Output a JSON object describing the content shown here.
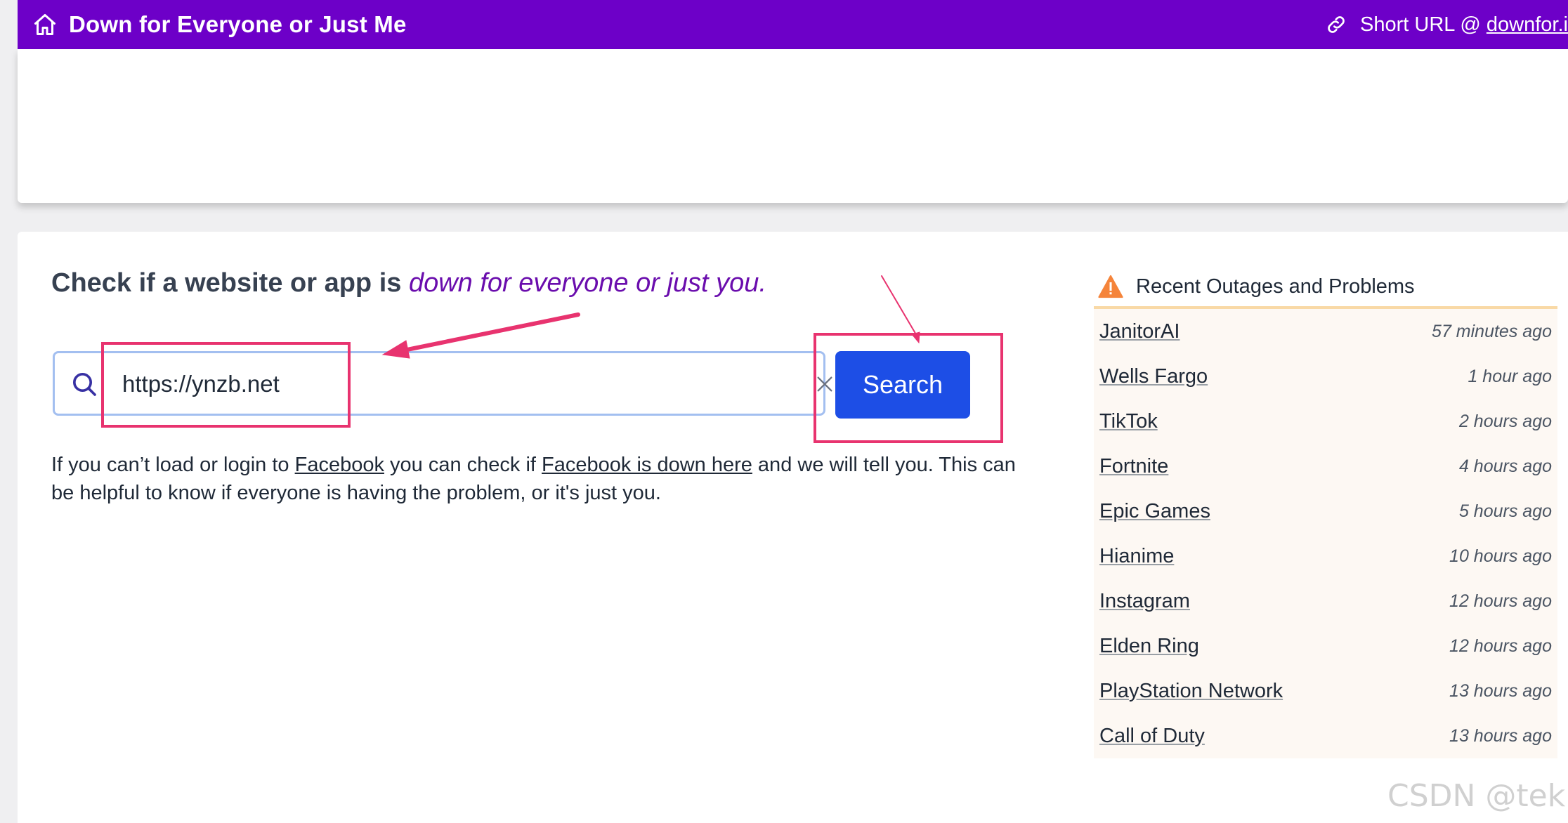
{
  "header": {
    "title": "Down for Everyone or Just Me",
    "short_url_prefix": "Short URL @ ",
    "short_url_link": "downfor.io"
  },
  "main": {
    "headline_prefix": "Check if a website or app is ",
    "headline_accent": "down for everyone or just you",
    "headline_suffix": ".",
    "search": {
      "value": "https://ynzb.net",
      "button_label": "Search"
    },
    "help": {
      "part1": "If you can’t load or login to ",
      "link1": "Facebook",
      "part2": " you can check if ",
      "link2": "Facebook is down here",
      "part3": " and we will tell you. This can be helpful to know if everyone is having the problem, or it's just you."
    }
  },
  "outages": {
    "title": "Recent Outages and Problems",
    "items": [
      {
        "name": "JanitorAI",
        "time": "57 minutes ago"
      },
      {
        "name": "Wells Fargo",
        "time": "1 hour ago"
      },
      {
        "name": "TikTok",
        "time": "2 hours ago"
      },
      {
        "name": "Fortnite",
        "time": "4 hours ago"
      },
      {
        "name": "Epic Games",
        "time": "5 hours ago"
      },
      {
        "name": "Hianime",
        "time": "10 hours ago"
      },
      {
        "name": "Instagram",
        "time": "12 hours ago"
      },
      {
        "name": "Elden Ring",
        "time": "12 hours ago"
      },
      {
        "name": "PlayStation Network",
        "time": "13 hours ago"
      },
      {
        "name": "Call of Duty",
        "time": "13 hours ago"
      }
    ]
  },
  "watermark": "CSDN @tekin",
  "colors": {
    "header_bg": "#6d00c8",
    "accent_text": "#6a0dad",
    "button_bg": "#1d4ee6",
    "annotation": "#e8336f",
    "warning": "#f5843a"
  }
}
